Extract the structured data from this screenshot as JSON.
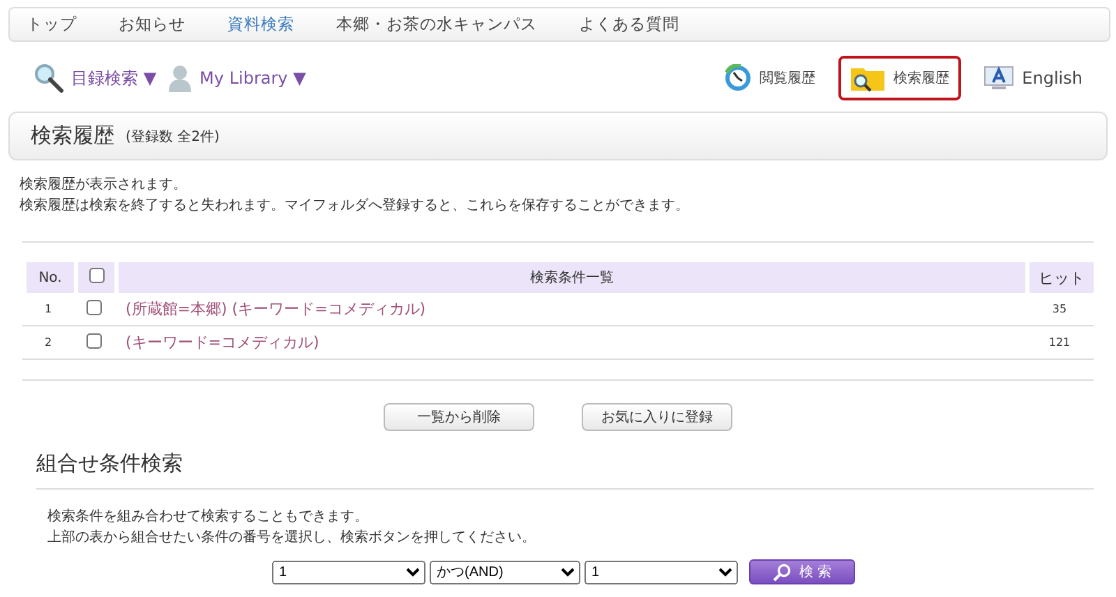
{
  "nav": [
    {
      "label": "トップ",
      "selected": false
    },
    {
      "label": "お知らせ",
      "selected": false
    },
    {
      "label": "資料検索",
      "selected": true
    },
    {
      "label": "本郷・お茶の水キャンパス",
      "selected": false
    },
    {
      "label": "よくある質問",
      "selected": false
    }
  ],
  "menus": [
    {
      "kind": "search",
      "label": "目録検索 ▼"
    },
    {
      "kind": "user",
      "label": "My Library ▼"
    }
  ],
  "links": [
    {
      "kind": "history",
      "label": "閲覧履歴",
      "selected": false
    },
    {
      "kind": "folder",
      "label": "検索履歴",
      "selected": true
    },
    {
      "kind": "language",
      "label": "English",
      "selected": false
    }
  ],
  "page_title": "検索履歴",
  "page_count": "(登録数 全2件)",
  "intro": [
    "検索履歴が表示されます。",
    "検索履歴は検索を終了すると失われます。マイフォルダへ登録すると、これらを保存することができます。"
  ],
  "table": {
    "columns": [
      "No.",
      "検索条件一覧",
      "ヒット"
    ],
    "header_checked": false,
    "rows": [
      {
        "no": "1",
        "checked": false,
        "condition": "(所蔵館=本郷) (キーワード=コメディカル)",
        "hits": "35"
      },
      {
        "no": "2",
        "checked": false,
        "condition": "(キーワード=コメディカル)",
        "hits": "121"
      }
    ]
  },
  "buttons": [
    "一覧から削除",
    "お気に入りに登録"
  ],
  "combine": {
    "title": "組合せ条件検索",
    "text": [
      "検索条件を組み合わせて検索することもできます。",
      "上部の表から組合せたい条件の番号を選択し、検索ボタンを押してください。"
    ],
    "selects": [
      "1",
      "かつ(AND)",
      "1"
    ],
    "search_button": "検 索"
  }
}
